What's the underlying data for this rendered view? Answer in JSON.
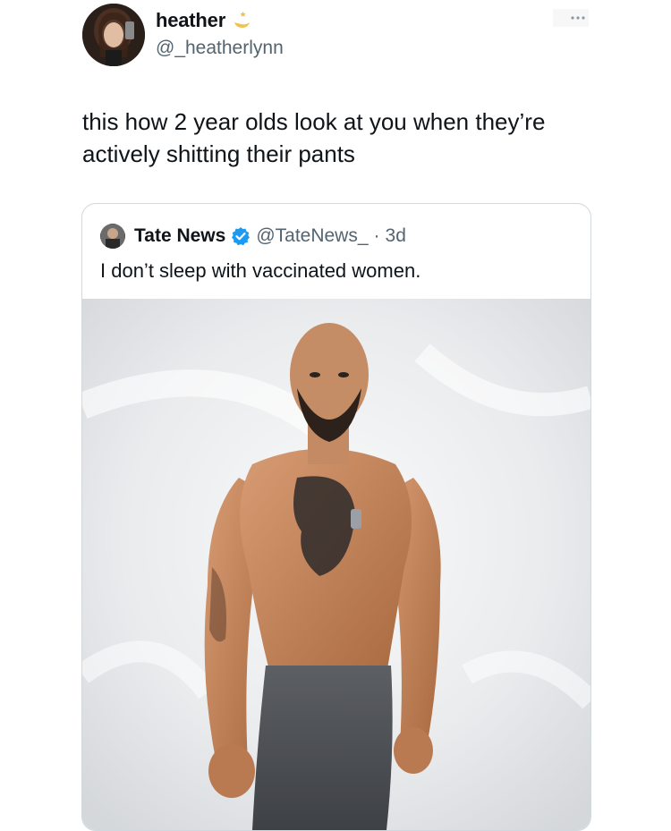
{
  "author": {
    "display_name": "heather",
    "handle": "@_heatherlynn",
    "avatar_icon": "profile-photo",
    "badge_icon": "crescent-moon-star-icon"
  },
  "menu": {
    "icon": "more-options-icon"
  },
  "tweet": {
    "text": "this how 2 year olds look at you when they’re actively shitting their pants"
  },
  "quoted": {
    "display_name": "Tate News",
    "verified_icon": "verified-badge-icon",
    "handle": "@TateNews_",
    "separator": "·",
    "time": "3d",
    "text": "I don’t sleep with vaccinated women.",
    "media": {
      "icon": "photo-shirtless-man",
      "accent_skin": "#c98a63",
      "background": "#eceef0"
    }
  },
  "colors": {
    "text_primary": "#0f1419",
    "text_secondary": "#536471",
    "verified_blue": "#1d9bf0",
    "border": "#cfd9de"
  }
}
